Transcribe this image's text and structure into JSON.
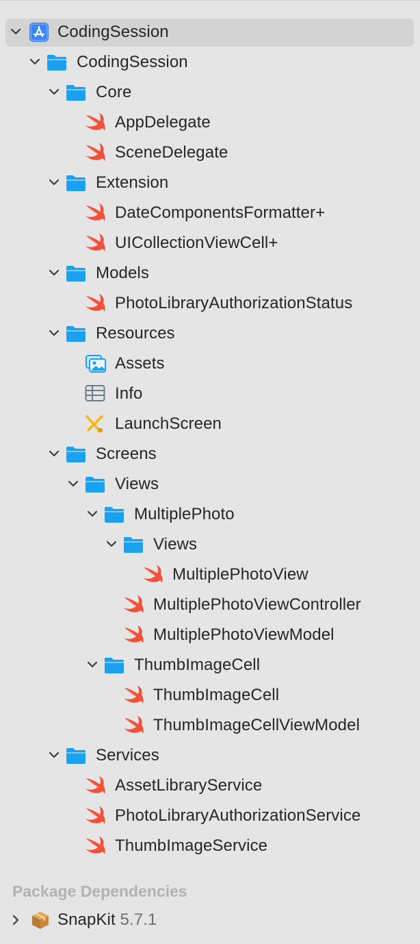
{
  "tree": {
    "project": {
      "label": "CodingSession",
      "icon": "xcode-project-icon"
    },
    "rows": [
      {
        "label": "CodingSession",
        "kind": "folder",
        "icon": "folder-icon"
      },
      {
        "label": "Core",
        "kind": "folder",
        "icon": "folder-icon"
      },
      {
        "label": "AppDelegate",
        "kind": "swift",
        "icon": "swift-file-icon"
      },
      {
        "label": "SceneDelegate",
        "kind": "swift",
        "icon": "swift-file-icon"
      },
      {
        "label": "Extension",
        "kind": "folder",
        "icon": "folder-icon"
      },
      {
        "label": "DateComponentsFormatter+",
        "kind": "swift",
        "icon": "swift-file-icon"
      },
      {
        "label": "UICollectionViewCell+",
        "kind": "swift",
        "icon": "swift-file-icon"
      },
      {
        "label": "Models",
        "kind": "folder",
        "icon": "folder-icon"
      },
      {
        "label": "PhotoLibraryAuthorizationStatus",
        "kind": "swift",
        "icon": "swift-file-icon"
      },
      {
        "label": "Resources",
        "kind": "folder",
        "icon": "folder-icon"
      },
      {
        "label": "Assets",
        "kind": "assets",
        "icon": "asset-catalog-icon"
      },
      {
        "label": "Info",
        "kind": "plist",
        "icon": "plist-table-icon"
      },
      {
        "label": "LaunchScreen",
        "kind": "storyboard",
        "icon": "storyboard-icon"
      },
      {
        "label": "Screens",
        "kind": "folder",
        "icon": "folder-icon"
      },
      {
        "label": "Views",
        "kind": "folder",
        "icon": "folder-icon"
      },
      {
        "label": "MultiplePhoto",
        "kind": "folder",
        "icon": "folder-icon"
      },
      {
        "label": "Views",
        "kind": "folder",
        "icon": "folder-icon"
      },
      {
        "label": "MultiplePhotoView",
        "kind": "swift",
        "icon": "swift-file-icon"
      },
      {
        "label": "MultiplePhotoViewController",
        "kind": "swift",
        "icon": "swift-file-icon"
      },
      {
        "label": "MultiplePhotoViewModel",
        "kind": "swift",
        "icon": "swift-file-icon"
      },
      {
        "label": "ThumbImageCell",
        "kind": "folder",
        "icon": "folder-icon"
      },
      {
        "label": "ThumbImageCell",
        "kind": "swift",
        "icon": "swift-file-icon"
      },
      {
        "label": "ThumbImageCellViewModel",
        "kind": "swift",
        "icon": "swift-file-icon"
      },
      {
        "label": "Services",
        "kind": "folder",
        "icon": "folder-icon"
      },
      {
        "label": "AssetLibraryService",
        "kind": "swift",
        "icon": "swift-file-icon"
      },
      {
        "label": "PhotoLibraryAuthorizationService",
        "kind": "swift",
        "icon": "swift-file-icon"
      },
      {
        "label": "ThumbImageService",
        "kind": "swift",
        "icon": "swift-file-icon"
      }
    ]
  },
  "package_dependencies": {
    "header": "Package Dependencies",
    "items": [
      {
        "name": "SnapKit",
        "version": "5.7.1",
        "icon": "package-box-icon"
      }
    ]
  },
  "colors": {
    "background": "#e6e5e6",
    "selection": "#d4d3d4",
    "folder": "#1ca1f1",
    "swift": "#f05138",
    "text": "#262626",
    "section_header": "#b3b2b3"
  }
}
